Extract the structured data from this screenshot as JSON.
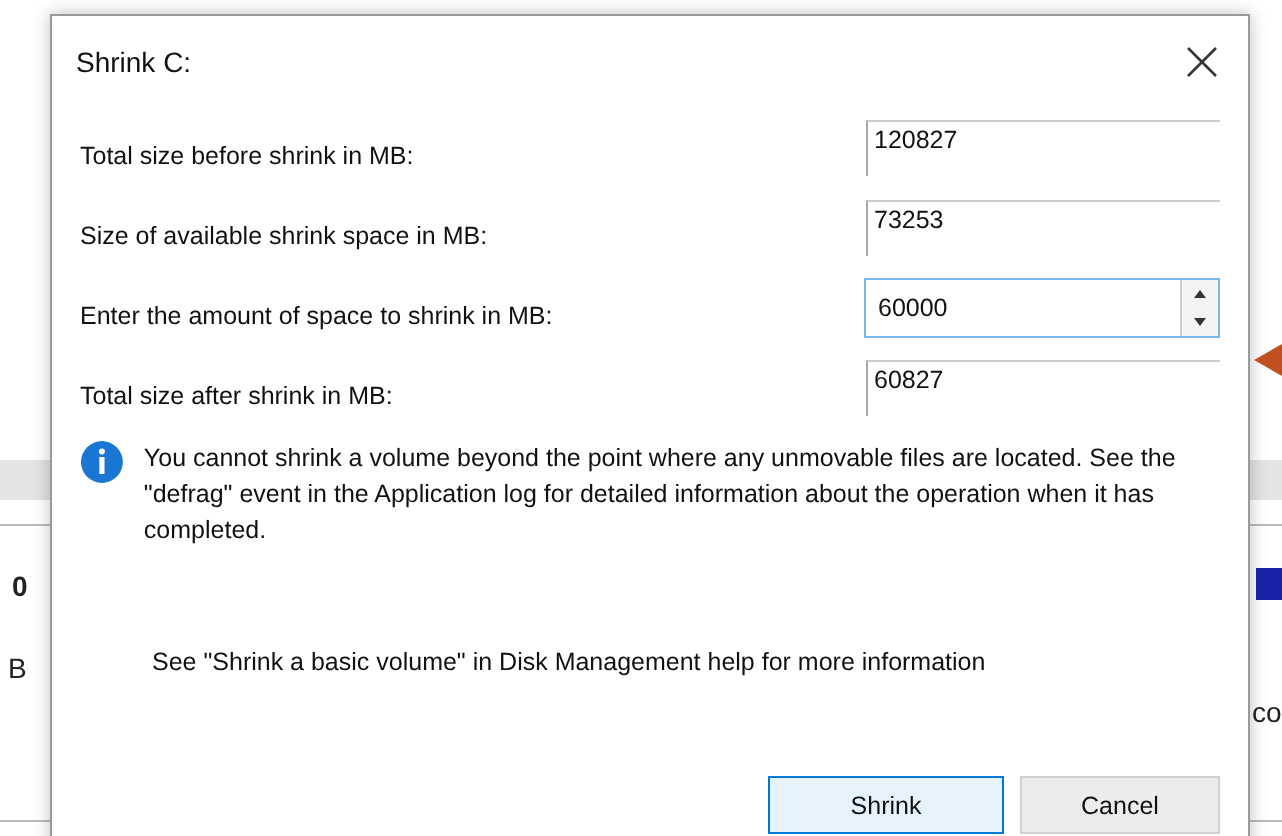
{
  "background": {
    "fragments": [
      "0",
      "B",
      "co"
    ]
  },
  "dialog": {
    "title": "Shrink C:",
    "fields": [
      {
        "label": "Total size before shrink in MB:",
        "value": "120827",
        "kind": "readonly"
      },
      {
        "label": "Size of available shrink space in MB:",
        "value": "73253",
        "kind": "readonly"
      },
      {
        "label": "Enter the amount of space to shrink in MB:",
        "value": "60000",
        "kind": "spinner"
      },
      {
        "label": "Total size after shrink in MB:",
        "value": "60827",
        "kind": "readonly"
      }
    ],
    "info": "You cannot shrink a volume beyond the point where any unmovable files are located. See the \"defrag\" event in the Application log for detailed information about the operation when it has completed.",
    "help": "See \"Shrink a basic volume\" in Disk Management help for more information",
    "buttons": [
      {
        "label": "Shrink",
        "selected": true
      },
      {
        "label": "Cancel",
        "selected": false
      }
    ]
  }
}
